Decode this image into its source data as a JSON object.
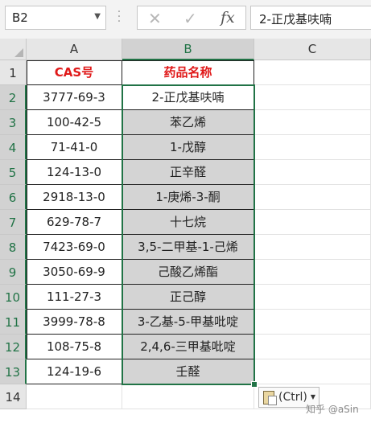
{
  "formula_bar": {
    "name_box": "B2",
    "cancel_icon": "✕",
    "enter_icon": "✓",
    "function_icon": "fx",
    "formula_value": "2-正戊基呋喃"
  },
  "columns": [
    "A",
    "B",
    "C"
  ],
  "rows": [
    "1",
    "2",
    "3",
    "4",
    "5",
    "6",
    "7",
    "8",
    "9",
    "10",
    "11",
    "12",
    "13",
    "14"
  ],
  "table": {
    "header": [
      "CAS号",
      "药品名称"
    ],
    "data": [
      [
        "3777-69-3",
        "2-正戊基呋喃"
      ],
      [
        "100-42-5",
        "苯乙烯"
      ],
      [
        "71-41-0",
        "1-戊醇"
      ],
      [
        "124-13-0",
        "正辛醛"
      ],
      [
        "2918-13-0",
        "1-庚烯-3-酮"
      ],
      [
        "629-78-7",
        "十七烷"
      ],
      [
        "7423-69-0",
        "3,5-二甲基-1-己烯"
      ],
      [
        "3050-69-9",
        "己酸乙烯酯"
      ],
      [
        "111-27-3",
        "正己醇"
      ],
      [
        "3999-78-8",
        "3-乙基-5-甲基吡啶"
      ],
      [
        "108-75-8",
        "2,4,6-三甲基吡啶"
      ],
      [
        "124-19-6",
        "壬醛"
      ]
    ]
  },
  "paste_options": {
    "label": "(Ctrl)"
  },
  "watermark": "知乎 @aSin",
  "colors": {
    "header_text": "#e01919",
    "selection": "#217346",
    "shaded_fill": "#d4d4d4"
  }
}
